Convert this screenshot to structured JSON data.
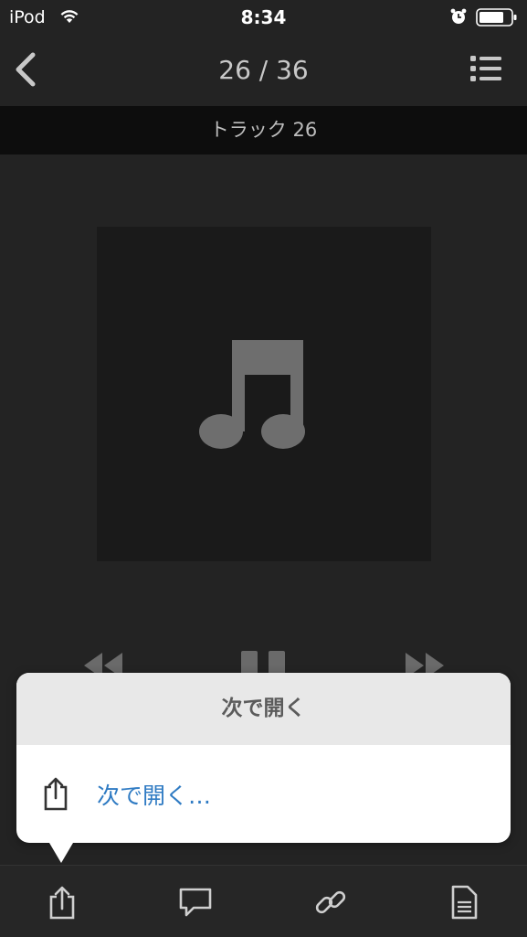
{
  "status_bar": {
    "carrier": "iPod",
    "time": "8:34"
  },
  "nav": {
    "title": "26 / 36",
    "back_icon": "chevron-left-icon",
    "list_icon": "list-icon"
  },
  "track": {
    "title": "トラック 26"
  },
  "artwork": {
    "icon": "music-note-icon"
  },
  "popover": {
    "header": "次で開く",
    "item_label": "次で開く…",
    "item_icon": "share-icon"
  },
  "toolbar": {
    "icons": [
      "share-icon",
      "comment-icon",
      "link-icon",
      "document-icon"
    ]
  },
  "colors": {
    "accent": "#2f7bc3",
    "background": "#232323"
  }
}
